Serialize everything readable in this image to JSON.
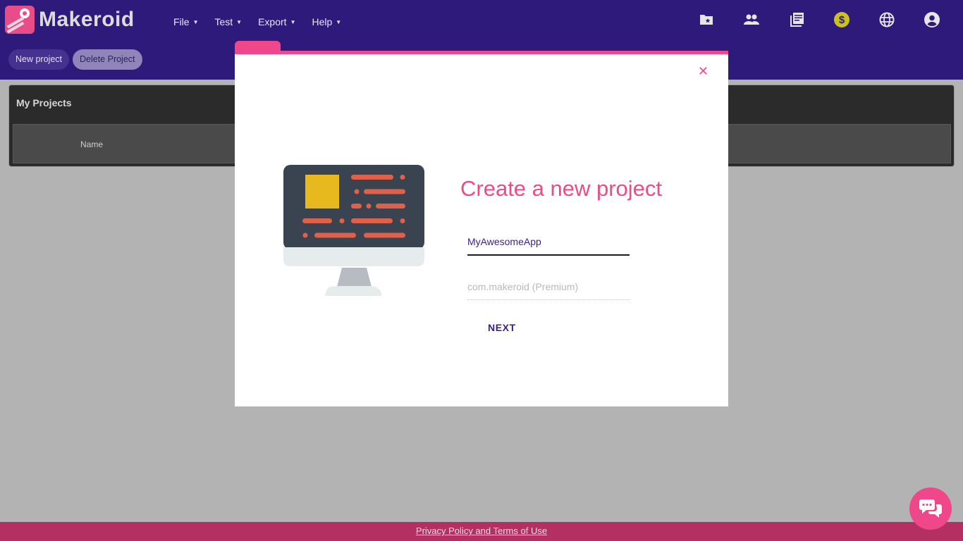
{
  "app": {
    "name": "Makeroid"
  },
  "menu": [
    {
      "label": "File"
    },
    {
      "label": "Test"
    },
    {
      "label": "Export"
    },
    {
      "label": "Help"
    }
  ],
  "header_icons": [
    "folder-star-icon",
    "people-icon",
    "library-icon",
    "dollar-icon",
    "globe-icon",
    "account-icon"
  ],
  "toolbar": {
    "new_project": "New project",
    "delete_project": "Delete Project"
  },
  "projects_panel": {
    "title": "My Projects",
    "columns": [
      "Name"
    ]
  },
  "dialog": {
    "title": "Create a new project",
    "close_label": "✕",
    "project_name_value": "MyAwesomeApp",
    "package_placeholder": "com.makeroid (Premium)",
    "next_label": "NEXT"
  },
  "footer": {
    "link": "Privacy Policy and Terms of Use"
  },
  "colors": {
    "header": "#2e1a7a",
    "accent": "#f0478a",
    "footer": "#b53062"
  }
}
